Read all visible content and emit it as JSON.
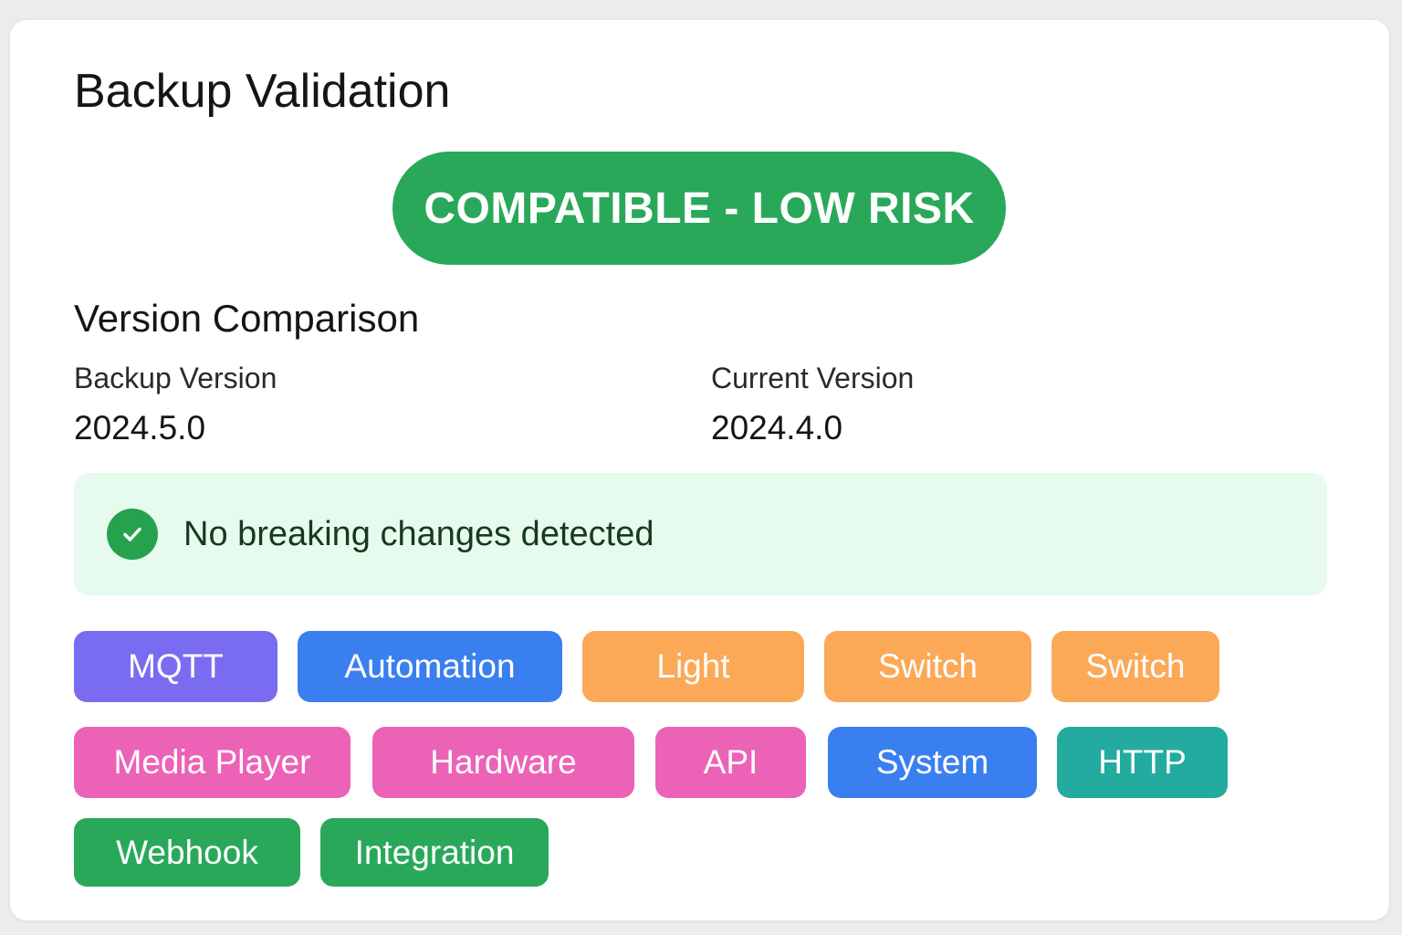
{
  "title": "Backup Validation",
  "status": {
    "label": "COMPATIBLE - LOW RISK",
    "color": "#2aa85a"
  },
  "comparison": {
    "heading": "Version Comparison",
    "backup_label": "Backup Version",
    "backup_value": "2024.5.0",
    "current_label": "Current Version",
    "current_value": "2024.4.0"
  },
  "notice": {
    "icon": "check-circle-icon",
    "text": "No breaking changes detected",
    "background": "#e6fbee",
    "icon_color": "#26a24f"
  },
  "tags": [
    {
      "label": "MQTT",
      "color": "#7a6cf0"
    },
    {
      "label": "Automation",
      "color": "#3a7ff0"
    },
    {
      "label": "Light",
      "color": "#fba957"
    },
    {
      "label": "Switch",
      "color": "#fba957"
    },
    {
      "label": "Switch",
      "color": "#fba957"
    },
    {
      "label": "Media Player",
      "color": "#ec62b6"
    },
    {
      "label": "Hardware",
      "color": "#ec62b6"
    },
    {
      "label": "API",
      "color": "#ec62b6"
    },
    {
      "label": "System",
      "color": "#3a7ff0"
    },
    {
      "label": "HTTP",
      "color": "#23ab9f"
    },
    {
      "label": "Webhook",
      "color": "#2aa85a"
    },
    {
      "label": "Integration",
      "color": "#2aa85a"
    }
  ]
}
